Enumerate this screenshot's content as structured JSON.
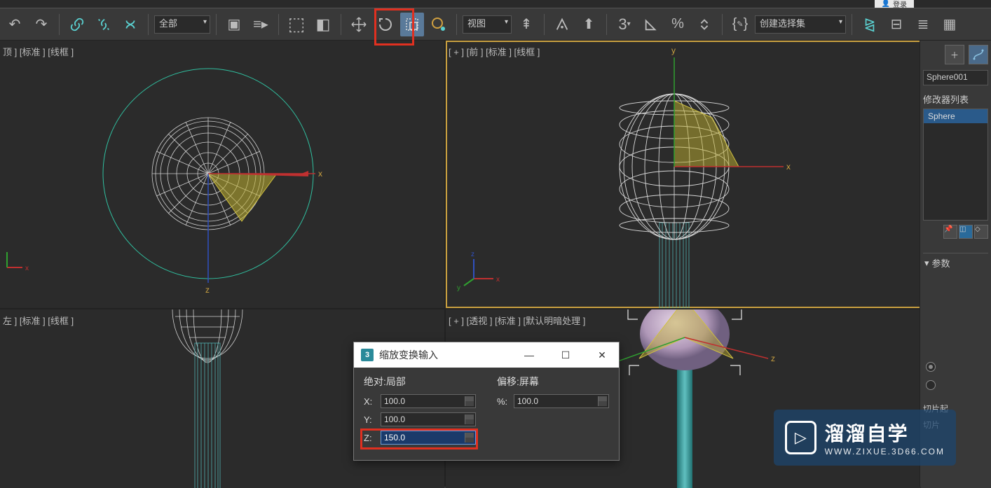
{
  "login": "登录",
  "toolbar": {
    "dd_all": "全部",
    "dd_view": "视图",
    "dd_selset": "创建选择集"
  },
  "viewports": {
    "top": "顶 ] [标准 ] [线框 ]",
    "front": "[ + ] [前 ] [标准 ] [线框 ]",
    "left": "左 ] [标准 ] [线框 ]",
    "persp": "[ + ] [透视 ] [标准 ] [默认明暗处理 ]"
  },
  "axes": {
    "x": "x",
    "y": "y",
    "z": "z"
  },
  "right": {
    "object_name": "Sphere001",
    "mod_list_label": "修改器列表",
    "mod_item": "Sphere",
    "rollout_params": "参数",
    "slice_start": "切片起",
    "slice": "切片"
  },
  "dialog": {
    "title": "缩放变换输入",
    "abs_local": "绝对:局部",
    "offset_screen": "偏移:屏幕",
    "x_label": "X:",
    "y_label": "Y:",
    "z_label": "Z:",
    "pct_label": "%:",
    "x_val": "100.0",
    "y_val": "100.0",
    "z_val": "150.0",
    "pct_val": "100.0"
  },
  "watermark": {
    "big": "溜溜自学",
    "small": "WWW.ZIXUE.3D66.COM"
  }
}
